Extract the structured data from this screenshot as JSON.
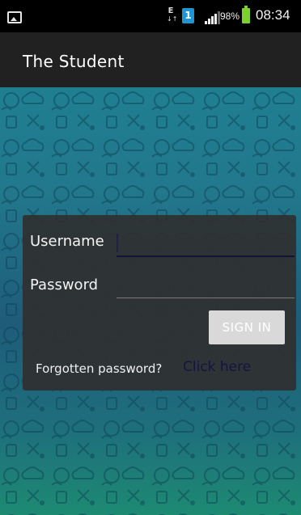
{
  "status_bar": {
    "data_indicator": "E",
    "data_arrows": "↓↑",
    "sim_slot": "1",
    "battery_percent": "98%",
    "time": "08:34",
    "battery_color": "#7dd12e",
    "sim_color": "#1e96d4"
  },
  "app": {
    "title": "The Student"
  },
  "login": {
    "username_label": "Username",
    "username_value": "",
    "password_label": "Password",
    "password_value": "",
    "signin_label": "SIGN IN",
    "forgot_text": "Forgotten password?",
    "click_here_text": "Click here"
  },
  "icons": {
    "screenshot": "image-icon",
    "signal": "signal-bars-icon",
    "battery": "battery-icon"
  }
}
